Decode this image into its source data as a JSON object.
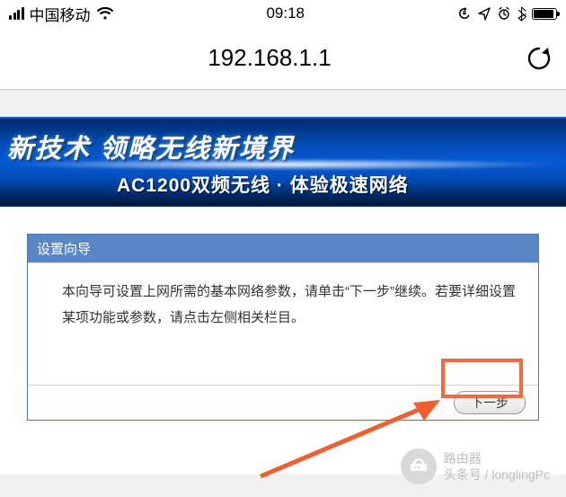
{
  "status": {
    "carrier": "中国移动",
    "time": "09:18"
  },
  "browser": {
    "url": "192.168.1.1"
  },
  "banner": {
    "line1": "新技术 领略无线新境界",
    "line2": "AC1200双频无线 · 体验极速网络"
  },
  "wizard": {
    "title": "设置向导",
    "body": "本向导可设置上网所需的基本网络参数，请单击“下一步”继续。若要详细设置某项功能或参数，请点击左侧相关栏目。",
    "next_label": "下一步"
  },
  "watermark": {
    "line1": "路由器",
    "line2": "头条号 / longlingPc"
  }
}
